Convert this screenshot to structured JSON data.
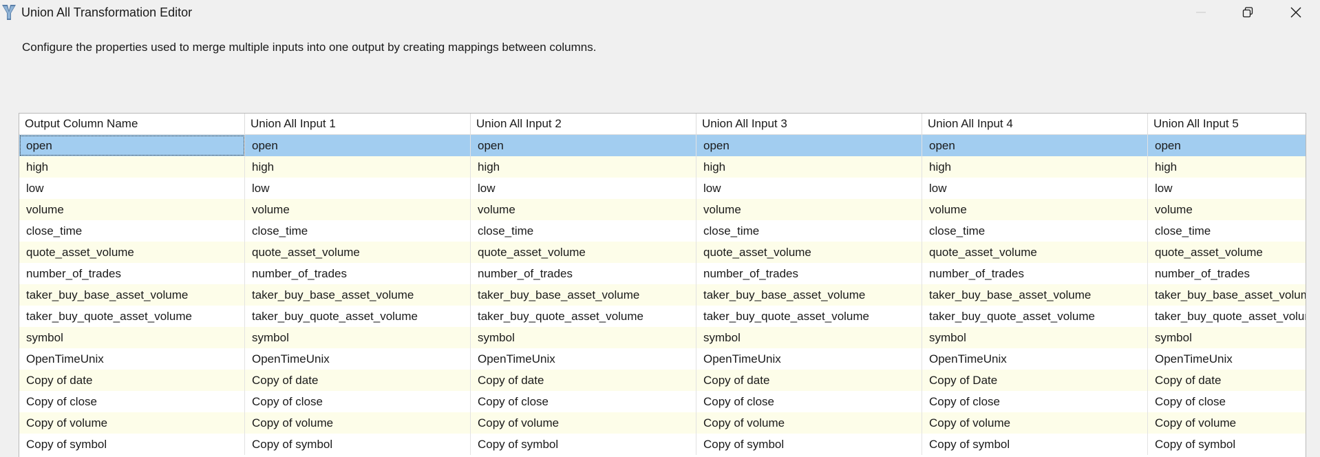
{
  "window": {
    "title": "Union All Transformation Editor",
    "icon": "ssis-transform-icon"
  },
  "description": "Configure the properties used to merge multiple inputs into one output by creating mappings between columns.",
  "grid": {
    "headers": [
      "Output Column Name",
      "Union All Input 1",
      "Union All Input 2",
      "Union All Input 3",
      "Union All Input 4",
      "Union All Input 5"
    ],
    "selected_row": 0,
    "rows": [
      [
        "open",
        "open",
        "open",
        "open",
        "open",
        "open"
      ],
      [
        "high",
        "high",
        "high",
        "high",
        "high",
        "high"
      ],
      [
        "low",
        "low",
        "low",
        "low",
        "low",
        "low"
      ],
      [
        "volume",
        "volume",
        "volume",
        "volume",
        "volume",
        "volume"
      ],
      [
        "close_time",
        "close_time",
        "close_time",
        "close_time",
        "close_time",
        "close_time"
      ],
      [
        "quote_asset_volume",
        "quote_asset_volume",
        "quote_asset_volume",
        "quote_asset_volume",
        "quote_asset_volume",
        "quote_asset_volume"
      ],
      [
        "number_of_trades",
        "number_of_trades",
        "number_of_trades",
        "number_of_trades",
        "number_of_trades",
        "number_of_trades"
      ],
      [
        "taker_buy_base_asset_volume",
        "taker_buy_base_asset_volume",
        "taker_buy_base_asset_volume",
        "taker_buy_base_asset_volume",
        "taker_buy_base_asset_volume",
        "taker_buy_base_asset_volume"
      ],
      [
        "taker_buy_quote_asset_volume",
        "taker_buy_quote_asset_volume",
        "taker_buy_quote_asset_volume",
        "taker_buy_quote_asset_volume",
        "taker_buy_quote_asset_volume",
        "taker_buy_quote_asset_volume"
      ],
      [
        "symbol",
        "symbol",
        "symbol",
        "symbol",
        "symbol",
        "symbol"
      ],
      [
        "OpenTimeUnix",
        "OpenTimeUnix",
        "OpenTimeUnix",
        "OpenTimeUnix",
        "OpenTimeUnix",
        "OpenTimeUnix"
      ],
      [
        "Copy of date",
        "Copy of date",
        "Copy of date",
        "Copy of date",
        "Copy of Date",
        "Copy of date"
      ],
      [
        "Copy of close",
        "Copy of close",
        "Copy of close",
        "Copy of close",
        "Copy of close",
        "Copy of close"
      ],
      [
        "Copy of volume",
        "Copy of volume",
        "Copy of volume",
        "Copy of volume",
        "Copy of volume",
        "Copy of volume"
      ],
      [
        "Copy of symbol",
        "Copy of symbol",
        "Copy of symbol",
        "Copy of symbol",
        "Copy of symbol",
        "Copy of symbol"
      ]
    ]
  },
  "colors": {
    "selected_row": "#a2cdf0",
    "alt_row": "#fdfde9",
    "row": "#ffffff"
  }
}
